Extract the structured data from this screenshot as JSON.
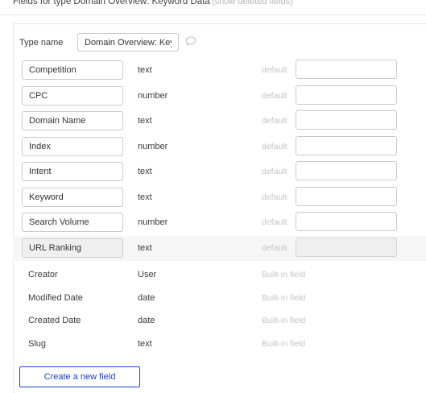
{
  "header": {
    "title": "Fields for type Domain Overview: Keyword Data",
    "show_deleted_link": "(show deleted fields)"
  },
  "type_name": {
    "label": "Type name",
    "value": "Domain Overview: Keyword Data"
  },
  "fields": [
    {
      "name": "Competition",
      "type": "text",
      "default_label": "default",
      "default_value": ""
    },
    {
      "name": "CPC",
      "type": "number",
      "default_label": "default",
      "default_value": ""
    },
    {
      "name": "Domain Name",
      "type": "text",
      "default_label": "default",
      "default_value": ""
    },
    {
      "name": "Index",
      "type": "number",
      "default_label": "default",
      "default_value": ""
    },
    {
      "name": "Intent",
      "type": "text",
      "default_label": "default",
      "default_value": ""
    },
    {
      "name": "Keyword",
      "type": "text",
      "default_label": "default",
      "default_value": ""
    },
    {
      "name": "Search Volume",
      "type": "number",
      "default_label": "default",
      "default_value": ""
    },
    {
      "name": "URL Ranking",
      "type": "text",
      "default_label": "default",
      "default_value": ""
    }
  ],
  "builtin_fields": [
    {
      "name": "Creator",
      "type": "User",
      "label": "Built-in field"
    },
    {
      "name": "Modified Date",
      "type": "date",
      "label": "Built-in field"
    },
    {
      "name": "Created Date",
      "type": "date",
      "label": "Built-in field"
    },
    {
      "name": "Slug",
      "type": "text",
      "label": "Built-in field"
    }
  ],
  "create_button_label": "Create a new field",
  "icons": {
    "comment": "comment-icon"
  },
  "colors": {
    "accent": "#1c3fd3",
    "muted_text": "#c4c4c4",
    "highlight_row": "#f6f6f6"
  }
}
